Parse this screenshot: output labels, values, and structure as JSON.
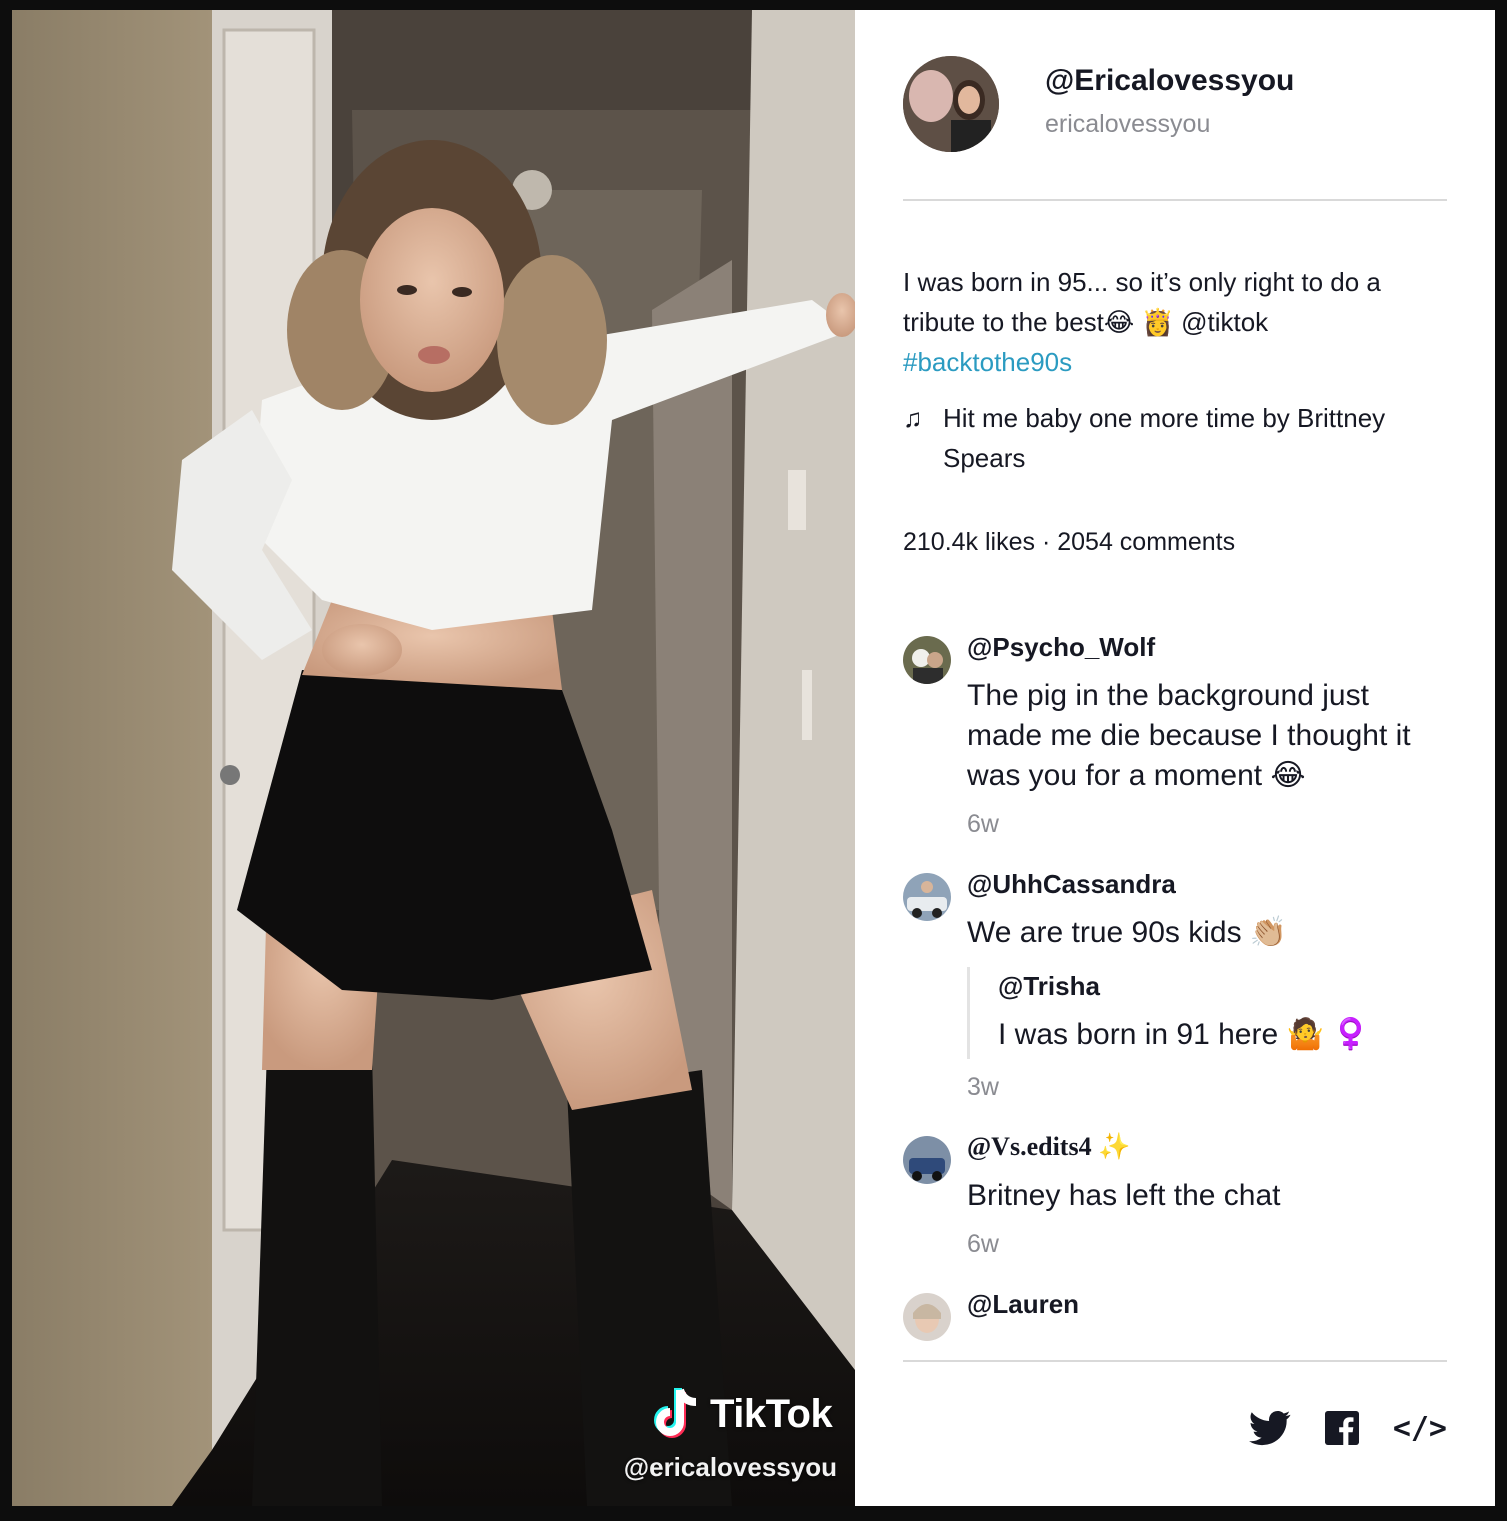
{
  "video": {
    "brand": "TikTok",
    "watermark_handle": "@ericalovessyou"
  },
  "profile": {
    "display_name": "@Ericalovessyou",
    "username": "ericalovessyou"
  },
  "caption": {
    "text_line": "I was born in 95... so it’s only right to do a tribute to the best😂 👸 ",
    "mention": "@tiktok",
    "hashtag": "#backtothe90s"
  },
  "music": {
    "note_icon": "♫",
    "title": "Hit me baby one more time by Brittney Spears"
  },
  "stats": {
    "text": "210.4k likes · 2054 comments"
  },
  "comments": [
    {
      "user": "@Psycho_Wolf",
      "text": "The pig in the background just made me die because I thought it was you for a moment 😂",
      "time": "6w"
    },
    {
      "user": "@UhhCassandra",
      "text": "We are true 90s kids 👏🏼",
      "reply_user": "@Trisha",
      "reply_text": "I was born in 91 here 🤷 ♀️",
      "time": "3w"
    },
    {
      "user": "@Vs.edits4 ✨",
      "text": "Britney has left the chat",
      "time": "6w"
    },
    {
      "user": "@Lauren"
    }
  ],
  "share": {
    "twitter_icon": "twitter-icon",
    "facebook_icon": "facebook-icon",
    "embed_label": "</>"
  },
  "colors": {
    "hashtag": "#2b9bc1",
    "muted": "#8a8b91",
    "text": "#161823"
  }
}
